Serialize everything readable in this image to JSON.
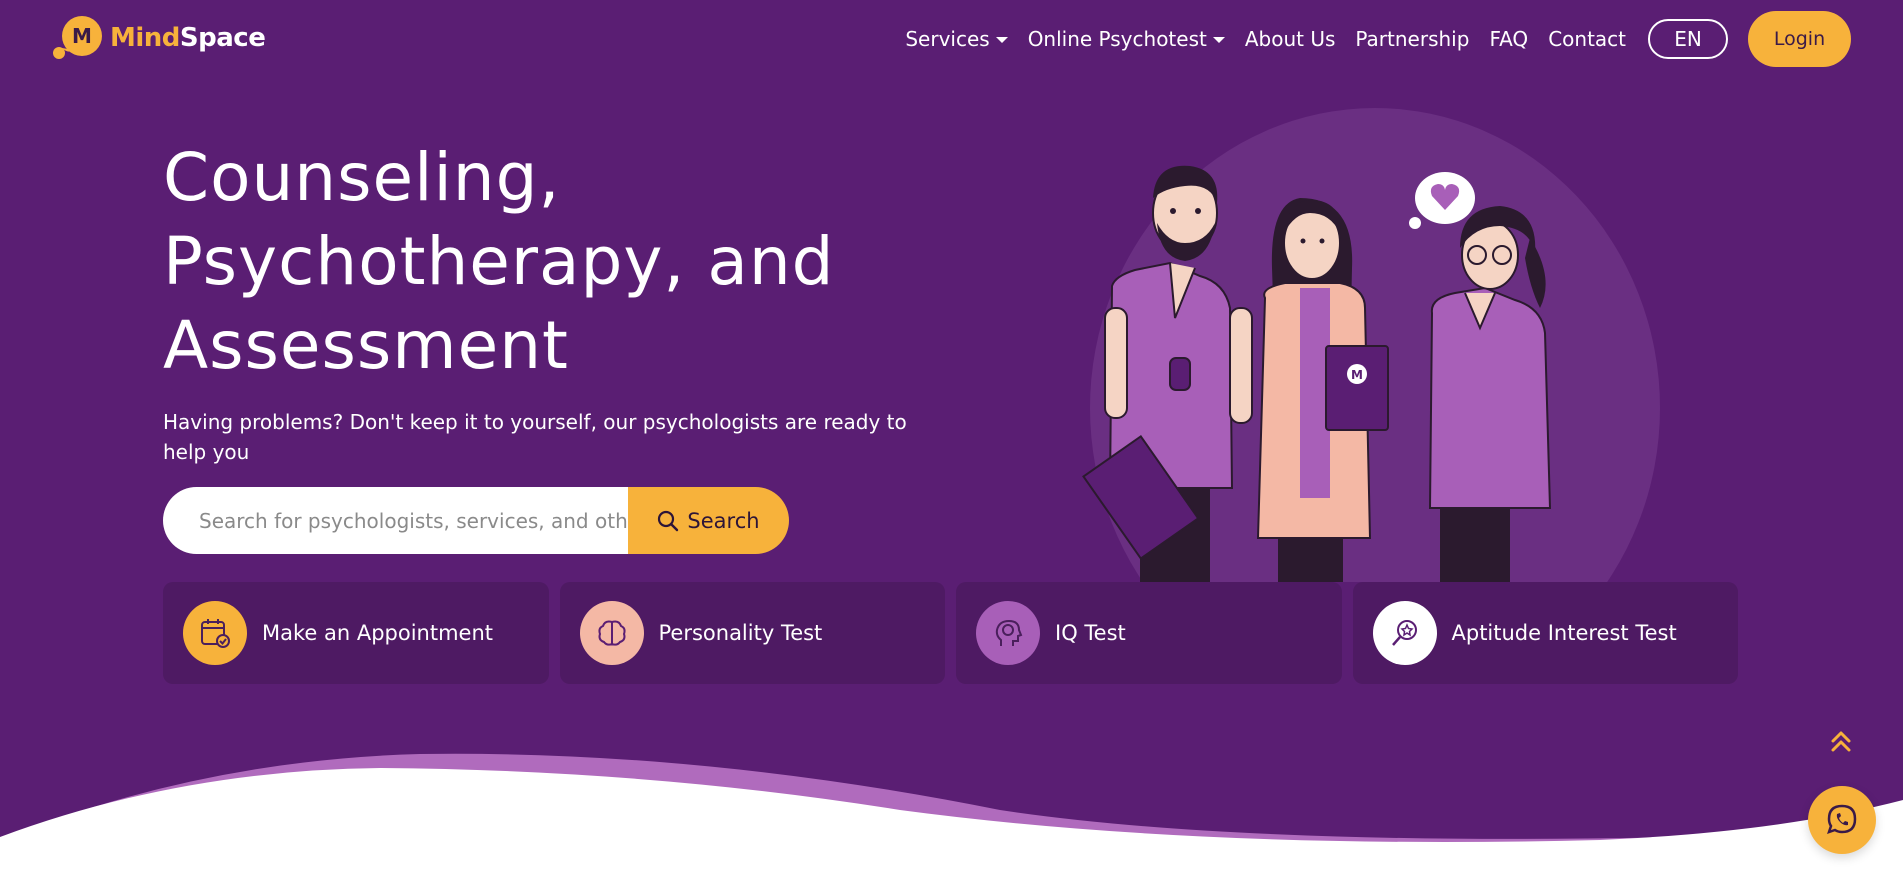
{
  "brand": {
    "name_part1": "Mind",
    "name_part2": "Space",
    "logo_letter": "M",
    "accent_color": "#f7b23b",
    "background_color": "#5a1e73"
  },
  "nav": {
    "items": [
      {
        "label": "Services",
        "has_dropdown": true
      },
      {
        "label": "Online Psychotest",
        "has_dropdown": true
      },
      {
        "label": "About Us",
        "has_dropdown": false
      },
      {
        "label": "Partnership",
        "has_dropdown": false
      },
      {
        "label": "FAQ",
        "has_dropdown": false
      },
      {
        "label": "Contact",
        "has_dropdown": false
      }
    ],
    "language": "EN",
    "login_label": "Login"
  },
  "hero": {
    "headline_line1": "Counseling,",
    "headline_line2": "Psychotherapy, and",
    "headline_line3": "Assessment",
    "subline": "Having problems? Don't keep it to yourself, our psychologists are ready to help you",
    "search_placeholder": "Search for psychologists, services, and others",
    "search_button_label": "Search",
    "illustration_badge_letter": "M"
  },
  "cards": [
    {
      "label": "Make an Appointment",
      "icon": "calendar-check-icon",
      "icon_bg": "#f7b23b"
    },
    {
      "label": "Personality Test",
      "icon": "brain-icon",
      "icon_bg": "#f4b8a5"
    },
    {
      "label": "IQ Test",
      "icon": "head-brain-icon",
      "icon_bg": "#a85fb8"
    },
    {
      "label": "Aptitude Interest Test",
      "icon": "star-magnifier-icon",
      "icon_bg": "#ffffff"
    }
  ],
  "floating": {
    "scroll_top_icon": "double-chevron-up-icon",
    "chat_icon": "whatsapp-icon"
  }
}
